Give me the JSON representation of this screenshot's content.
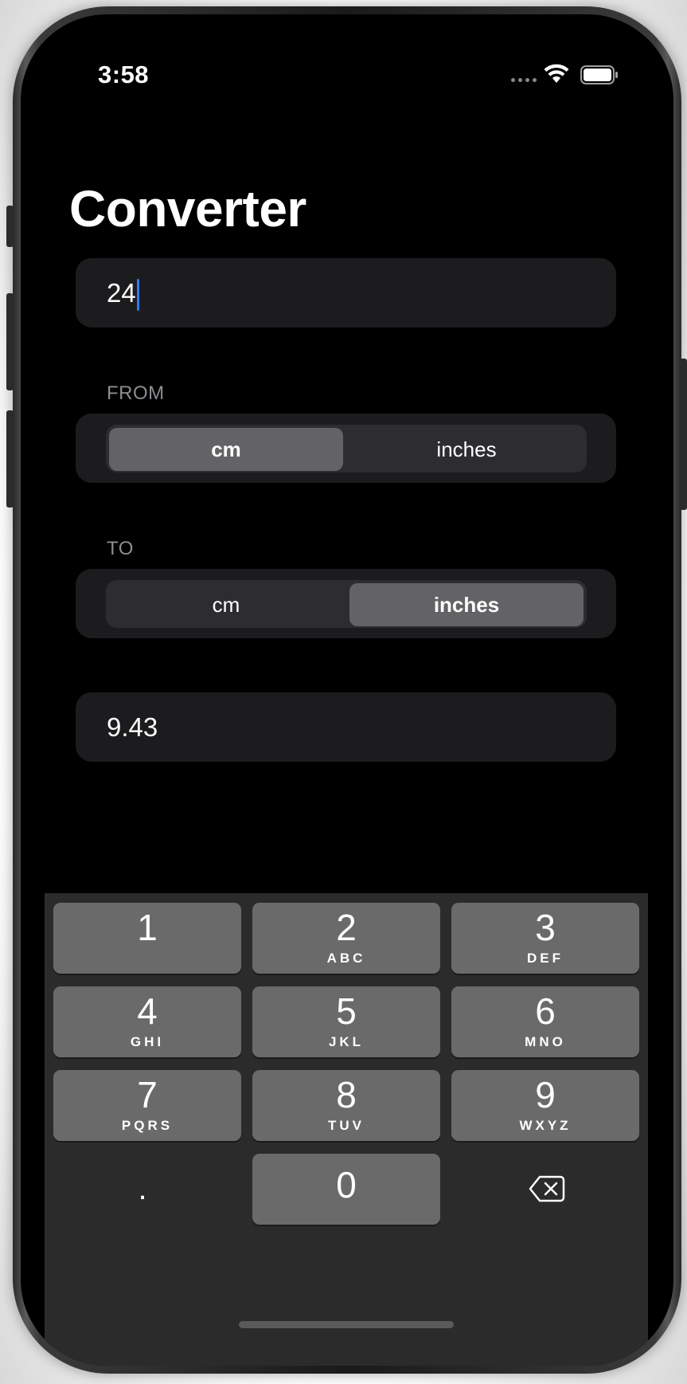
{
  "status_bar": {
    "time": "3:58"
  },
  "app": {
    "title": "Converter"
  },
  "input": {
    "value": "24"
  },
  "from_section": {
    "label": "FROM",
    "options": [
      "cm",
      "inches"
    ],
    "selected": "cm"
  },
  "to_section": {
    "label": "TO",
    "options": [
      "cm",
      "inches"
    ],
    "selected": "inches"
  },
  "result": {
    "value": "9.43"
  },
  "keyboard": {
    "keys": [
      {
        "num": "1",
        "letters": ""
      },
      {
        "num": "2",
        "letters": "ABC"
      },
      {
        "num": "3",
        "letters": "DEF"
      },
      {
        "num": "4",
        "letters": "GHI"
      },
      {
        "num": "5",
        "letters": "JKL"
      },
      {
        "num": "6",
        "letters": "MNO"
      },
      {
        "num": "7",
        "letters": "PQRS"
      },
      {
        "num": "8",
        "letters": "TUV"
      },
      {
        "num": "9",
        "letters": "WXYZ"
      },
      {
        "num": "0",
        "letters": ""
      }
    ],
    "decimal": ".",
    "delete_icon": "delete-backward-icon"
  },
  "colors": {
    "background": "#000000",
    "field": "#1c1c1e",
    "segment_track": "#2d2d31",
    "segment_selected": "#636366",
    "caret": "#2f7bf5",
    "keyboard_bg": "#2b2b2b",
    "key": "#6a6a6a"
  }
}
